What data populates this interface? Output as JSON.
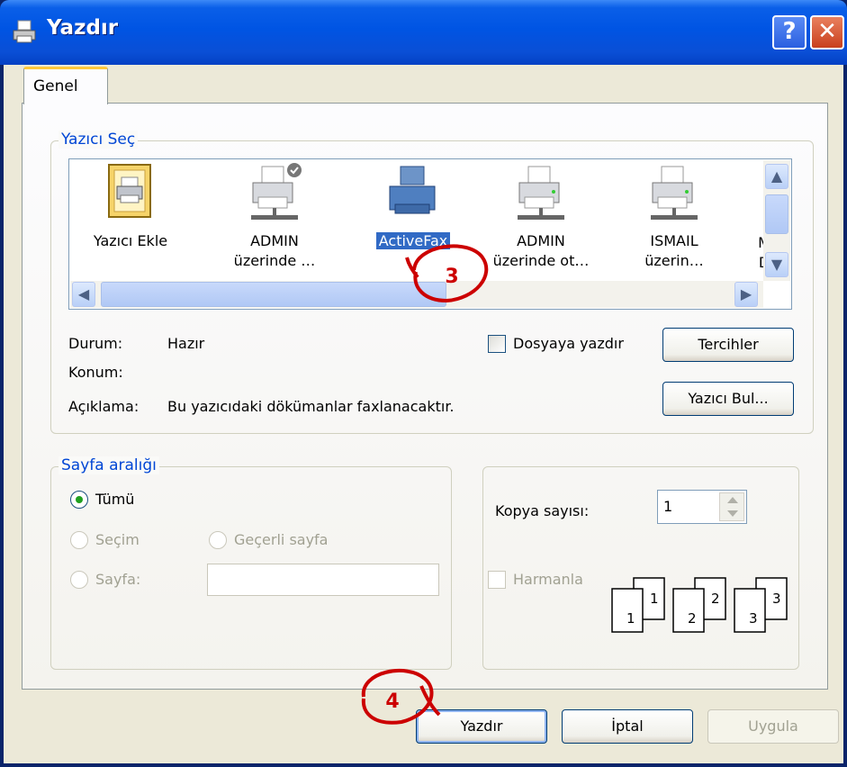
{
  "window": {
    "title": "Yazdır",
    "help_glyph": "?",
    "close_glyph": "✕"
  },
  "tabs": [
    {
      "label": "Genel",
      "selected": true
    }
  ],
  "select_printer": {
    "title": "Yazıcı Seç",
    "printers": [
      {
        "line1": "Yazıcı Ekle",
        "line2": "",
        "icon": "add-printer-icon",
        "selected": false
      },
      {
        "line1": "ADMIN",
        "line2": "üzerinde …",
        "icon": "network-printer-default-icon",
        "selected": false
      },
      {
        "line1": "ActiveFax",
        "line2": "",
        "icon": "fax-printer-icon",
        "selected": true
      },
      {
        "line1": "ADMIN",
        "line2": "üzerinde ot…",
        "icon": "network-printer-icon",
        "selected": false
      },
      {
        "line1": "ISMAIL",
        "line2": "üzerin…",
        "icon": "network-printer-icon",
        "selected": false
      },
      {
        "line1": "M",
        "line2": "D",
        "icon": "network-printer-icon",
        "selected": false
      }
    ],
    "status_label": "Durum:",
    "status_value": "Hazır",
    "location_label": "Konum:",
    "location_value": "",
    "comment_label": "Açıklama:",
    "comment_value": "Bu yazıcıdaki dökümanlar faxlanacaktır.",
    "print_to_file_label": "Dosyaya yazdır",
    "print_to_file_checked": false,
    "preferences_button": "Tercihler",
    "find_printer_button": "Yazıcı Bul..."
  },
  "page_range": {
    "title": "Sayfa aralığı",
    "all_label": "Tümü",
    "selection_label": "Seçim",
    "current_page_label": "Geçerli sayfa",
    "pages_label": "Sayfa:",
    "pages_value": "",
    "selected": "all"
  },
  "copies": {
    "count_label": "Kopya sayısı:",
    "count_value": "1",
    "collate_label": "Harmanla",
    "collate_checked": false,
    "collate_pages": [
      "1",
      "1",
      "2",
      "2",
      "3",
      "3"
    ]
  },
  "buttons": {
    "print": "Yazdır",
    "cancel": "İptal",
    "apply": "Uygula"
  },
  "annotations": {
    "step3": "3",
    "step4": "4"
  },
  "colors": {
    "title_bar": "#0054e3",
    "selection": "#316ac5",
    "group_title": "#0046d5",
    "annotation": "#cc0000"
  }
}
